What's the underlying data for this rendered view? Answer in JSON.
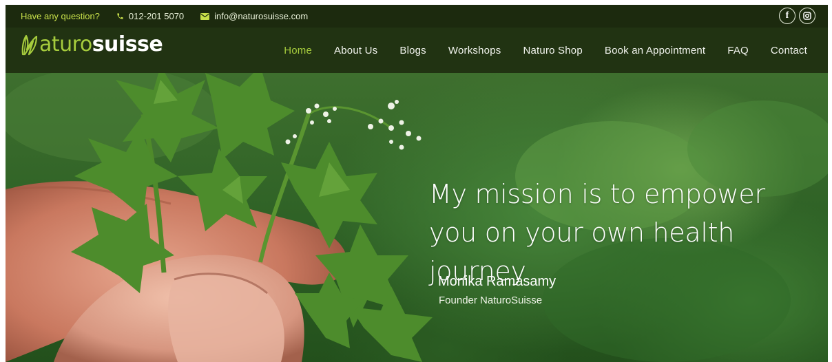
{
  "topbar": {
    "question": "Have any question?",
    "phone": "012-201 5070",
    "email": "info@naturosuisse.com",
    "phone_icon": "phone-icon",
    "email_icon": "envelope-icon",
    "social": [
      {
        "name": "facebook-icon",
        "glyph": "f"
      },
      {
        "name": "instagram-icon",
        "glyph": ""
      }
    ]
  },
  "logo": {
    "part1": "aturo",
    "part2": "suisse",
    "leaf_letter": "N"
  },
  "nav": {
    "items": [
      {
        "label": "Home",
        "active": true
      },
      {
        "label": "About Us"
      },
      {
        "label": "Blogs"
      },
      {
        "label": "Workshops"
      },
      {
        "label": "Naturo Shop"
      },
      {
        "label": "Book an Appointment"
      },
      {
        "label": "FAQ"
      },
      {
        "label": "Contact"
      }
    ]
  },
  "hero": {
    "quote_line1": "My mission is to empower",
    "quote_line2": "you on your own health journey",
    "author": "Monika Ramasamy",
    "role": "Founder NaturoSuisse"
  },
  "colors": {
    "accent": "#a6cc3d",
    "topbar_bg": "#1c2a0e",
    "question": "#c8e04a"
  }
}
